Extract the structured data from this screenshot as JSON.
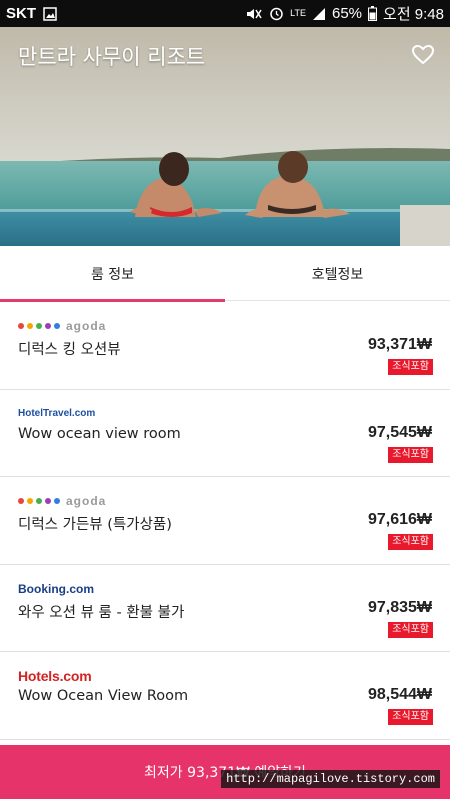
{
  "status_bar": {
    "carrier": "SKT",
    "network": "LTE",
    "battery": "65%",
    "time": "오전 9:48",
    "icons": [
      "image-icon",
      "mute-icon",
      "alarm-icon",
      "signal-icon",
      "battery-icon"
    ]
  },
  "hero": {
    "title": "만트라 사무이 리조트",
    "favorite_icon": "heart-outline-icon"
  },
  "tabs": [
    {
      "label": "룸 정보",
      "active": true
    },
    {
      "label": "호텔정보",
      "active": false
    }
  ],
  "rooms": [
    {
      "provider": "agoda",
      "provider_label": "agoda",
      "name": "디럭스 킹 오션뷰",
      "price": "93,371₩",
      "badge": "조식포함"
    },
    {
      "provider": "hoteltravel",
      "provider_label": "HotelTravel.com",
      "name": "Wow ocean view room",
      "price": "97,545₩",
      "badge": "조식포함"
    },
    {
      "provider": "agoda",
      "provider_label": "agoda",
      "name": "디럭스 가든뷰 (특가상품)",
      "price": "97,616₩",
      "badge": "조식포함"
    },
    {
      "provider": "booking",
      "provider_label": "Booking.com",
      "name": "와우 오션 뷰 룸 - 환불 불가",
      "price": "97,835₩",
      "badge": "조식포함"
    },
    {
      "provider": "hotels",
      "provider_label": "Hotels.com",
      "name": "Wow Ocean View Room",
      "price": "98,544₩",
      "badge": "조식포함"
    }
  ],
  "cta": {
    "label": "최저가 93,371₩ 예약하기"
  },
  "watermark": "http://mapagilove.tistory.com",
  "colors": {
    "accent": "#e6336a",
    "badge": "#e8192c",
    "tab_indicator": "#e33c6b"
  }
}
